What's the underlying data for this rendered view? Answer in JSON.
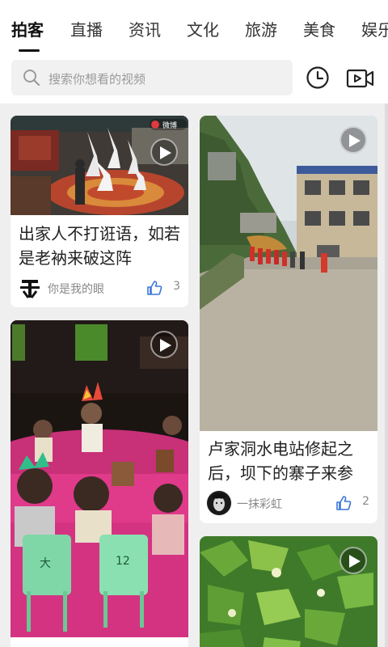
{
  "tabs": [
    "拍客",
    "直播",
    "资讯",
    "文化",
    "旅游",
    "美食",
    "娱乐"
  ],
  "active_tab_index": 0,
  "search": {
    "placeholder": "搜索你想看的视频"
  },
  "icons": {
    "search": "search-icon",
    "history": "clock-icon",
    "video": "video-camera-icon",
    "play": "play-icon",
    "like": "thumbs-up-icon"
  },
  "colors": {
    "like_blue": "#3b76d8",
    "text": "#222222",
    "meta": "#888888",
    "background": "#efefef"
  },
  "cards": [
    {
      "title": "出家人不打诳语，如若是老衲来破这阵",
      "author": "你是我的眼",
      "likes": "3",
      "thumb_text": "微博"
    },
    {
      "title": "卢家洞水电站修起之后，坝下的寨子来参",
      "author": "一抹彩虹",
      "likes": "2"
    },
    {
      "title": "",
      "thumb_text_1": "大",
      "thumb_text_2": "12"
    },
    {
      "title": ""
    }
  ]
}
